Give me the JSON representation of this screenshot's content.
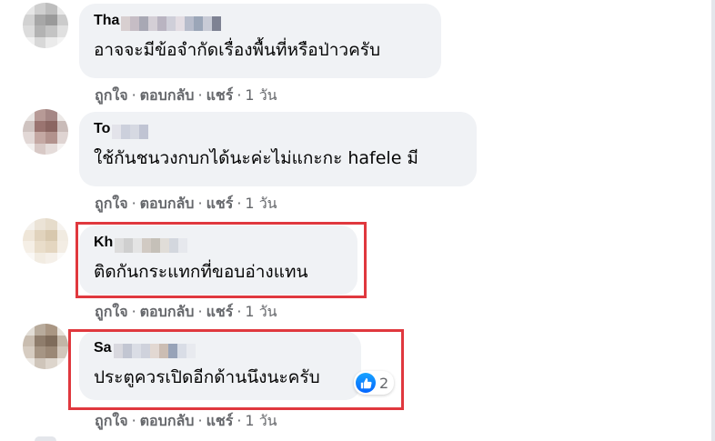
{
  "comments": [
    {
      "author_visible": "Tha",
      "text": "อาจจะมีข้อจำกัดเรื่องพื้นที่หรือป่าวครับ",
      "actions": {
        "like": "ถูกใจ",
        "reply": "ตอบกลับ",
        "share": "แชร์",
        "time": "1 วัน"
      }
    },
    {
      "author_visible": "To",
      "text": "ใช้กันชนวงกบกได้นะค่ะไม่แกะกะ hafele มี",
      "actions": {
        "like": "ถูกใจ",
        "reply": "ตอบกลับ",
        "share": "แชร์",
        "time": "1 วัน"
      }
    },
    {
      "author_visible": "Kh",
      "text": "ติดกันกระแทกที่ขอบอ่างแทน",
      "actions": {
        "like": "ถูกใจ",
        "reply": "ตอบกลับ",
        "share": "แชร์",
        "time": "1 วัน"
      },
      "highlighted": true
    },
    {
      "author_visible": "Sa",
      "text": "ประตูควรเปิดอีกด้านนึงนะครับ",
      "reactions": {
        "icon": "like-icon",
        "count": "2"
      },
      "actions": {
        "like": "ถูกใจ",
        "reply": "ตอบกลับ",
        "share": "แชร์",
        "time": "1 วัน"
      },
      "highlighted": true
    }
  ],
  "colors": {
    "bubble": "#f0f2f5",
    "action_text": "#65676b",
    "highlight": "#e0383e",
    "like_blue": "#1877f2"
  }
}
